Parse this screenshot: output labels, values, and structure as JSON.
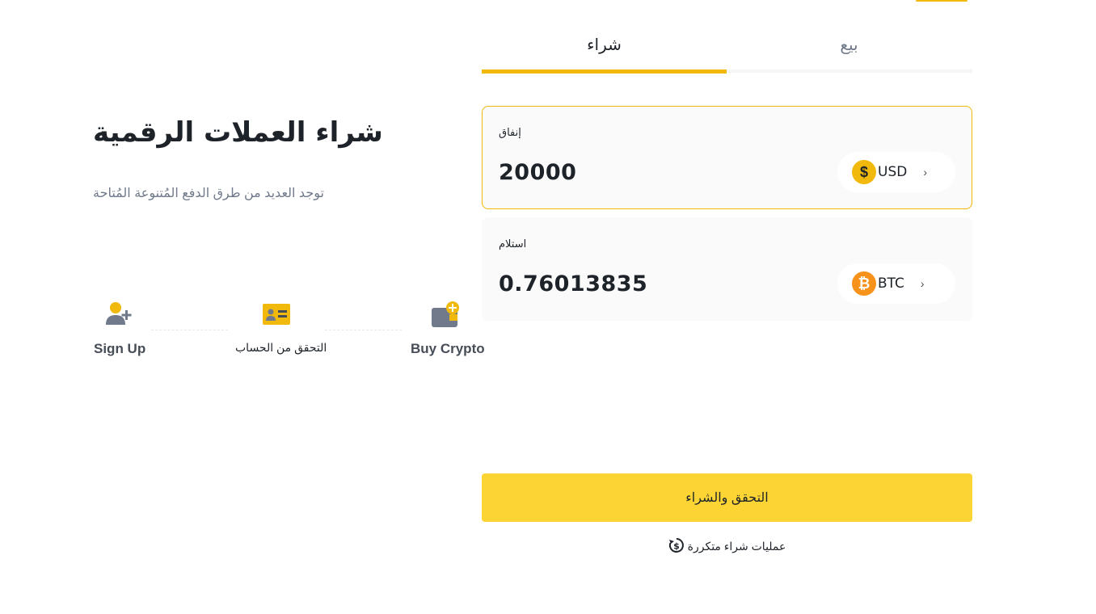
{
  "colors": {
    "brand_yellow": "#f0b90b",
    "button_yellow": "#fcd535",
    "text_primary": "#1e2329",
    "text_secondary": "#707a8a"
  },
  "hero": {
    "title": "شراء العملات الرقمية",
    "subtitle": "توجد العديد من طرق الدفع المُتنوعة المُتاحة"
  },
  "steps": [
    {
      "icon": "add-user-icon",
      "label": "Sign Up"
    },
    {
      "icon": "id-card-icon",
      "label": "التحقق من الحساب"
    },
    {
      "icon": "wallet-icon",
      "label": "Buy Crypto"
    }
  ],
  "tabs": {
    "buy": "شراء",
    "sell": "بيع",
    "active": "buy"
  },
  "spend": {
    "label": "إنفاق",
    "amount": "20000",
    "currency": "USD",
    "currency_icon": "dollar-coin-icon"
  },
  "receive": {
    "label": "استلام",
    "amount": "0.76013835",
    "currency": "BTC",
    "currency_icon": "bitcoin-icon"
  },
  "cta": {
    "label": "التحقق والشراء"
  },
  "recurring": {
    "label": "عمليات شراء متكررة",
    "icon": "recurring-dollar-icon"
  }
}
